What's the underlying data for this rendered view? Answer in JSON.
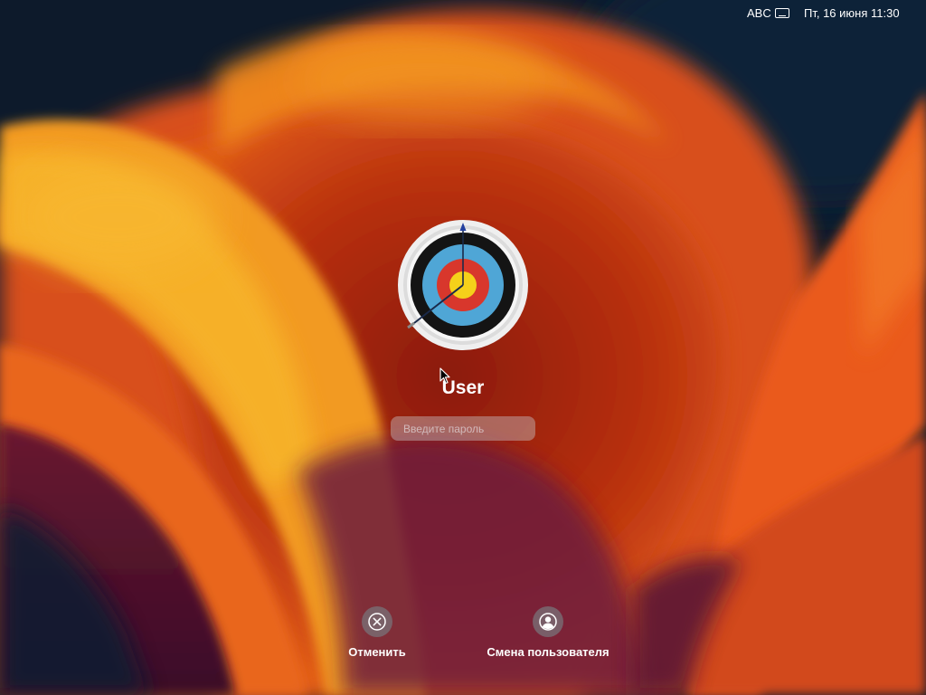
{
  "menubar": {
    "input_source": "ABC",
    "input_icon": "keyboard-icon",
    "clock": "Пт, 16 июня 11:30"
  },
  "login": {
    "avatar_icon": "archery-target-icon",
    "username": "User",
    "password_placeholder": "Введите пароль"
  },
  "actions": {
    "cancel": {
      "label": "Отменить",
      "icon": "close-circle-icon"
    },
    "switch_user": {
      "label": "Смена пользователя",
      "icon": "person-icon"
    }
  },
  "colors": {
    "wallpaper_dark": "#0d1a2b",
    "wallpaper_orange": "#f0701a",
    "wallpaper_yellow": "#f6a51e",
    "wallpaper_red": "#b0220f",
    "wallpaper_purple": "#5a1438"
  }
}
